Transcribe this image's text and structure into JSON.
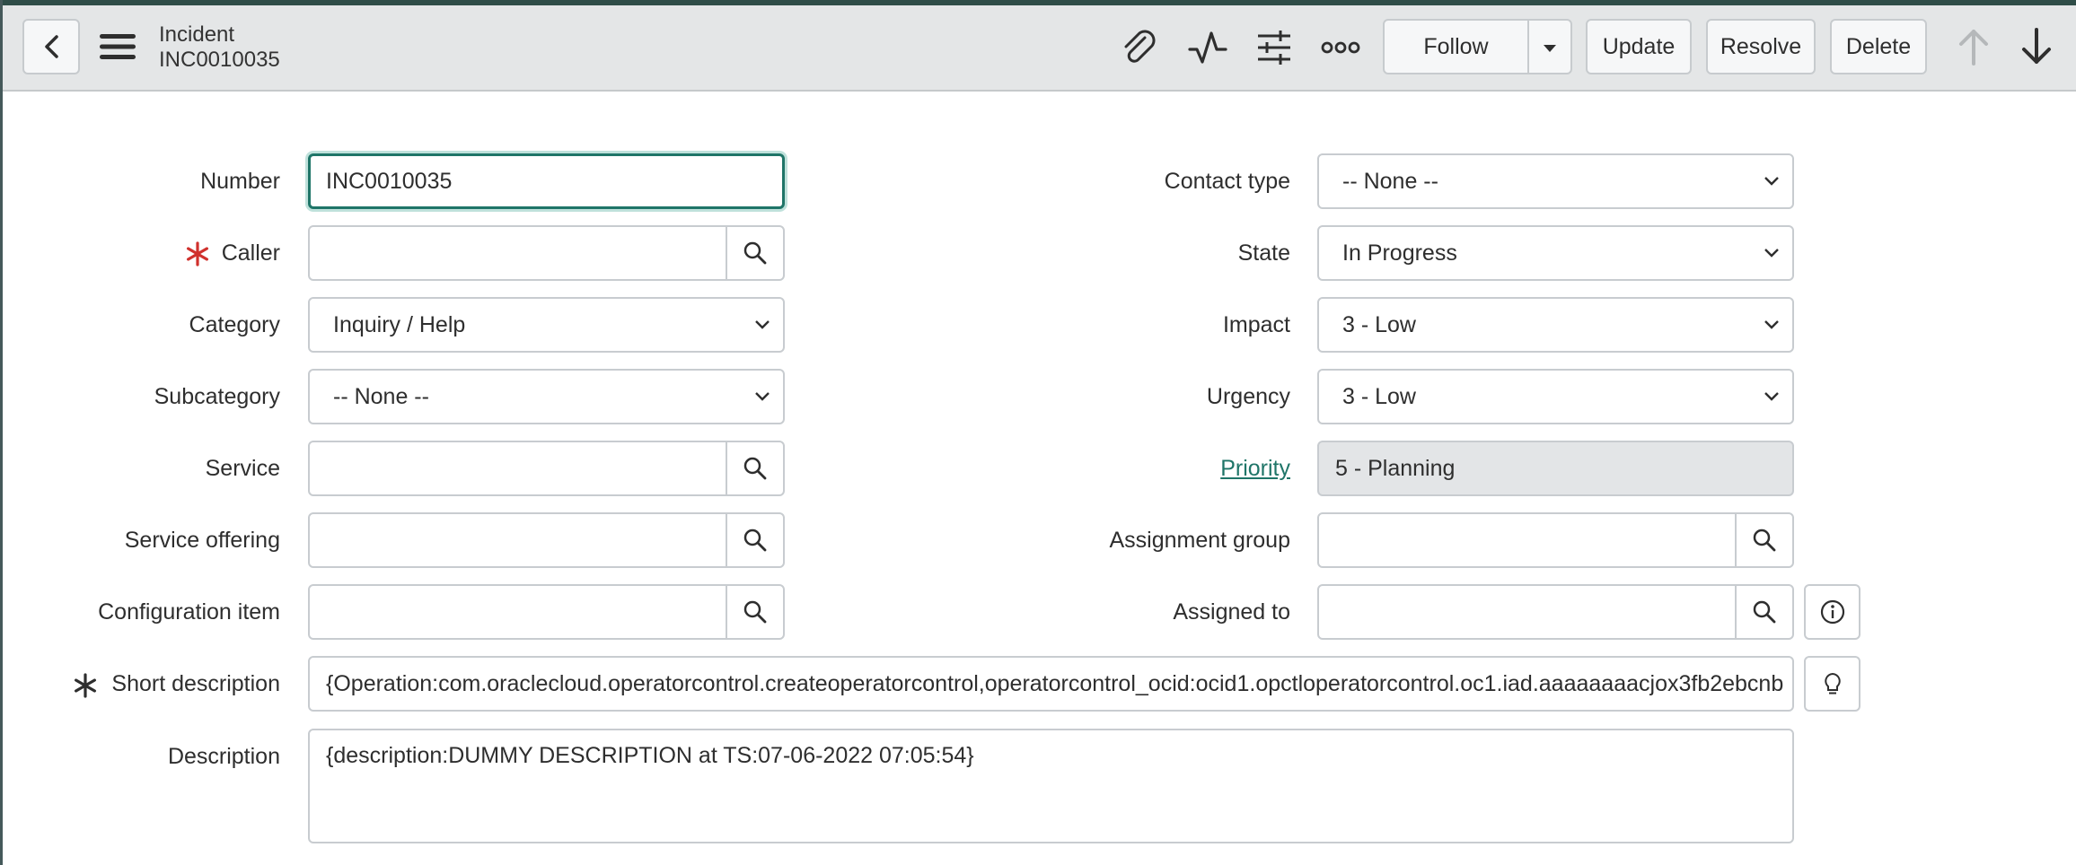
{
  "header": {
    "back_icon": "chevron-left-icon",
    "menu_icon": "hamburger-menu-icon",
    "title": "Incident",
    "subtitle": "INC0010035",
    "icons": [
      "paperclip-icon",
      "activity-pulse-icon",
      "sliders-icon",
      "more-dots-icon"
    ],
    "follow_label": "Follow",
    "update_label": "Update",
    "resolve_label": "Resolve",
    "delete_label": "Delete",
    "up_icon": "arrow-up-icon",
    "down_icon": "arrow-down-icon"
  },
  "form": {
    "number": {
      "label": "Number",
      "value": "INC0010035"
    },
    "caller": {
      "label": "Caller",
      "value": ""
    },
    "category": {
      "label": "Category",
      "value": "Inquiry / Help"
    },
    "subcategory": {
      "label": "Subcategory",
      "value": "-- None --"
    },
    "service": {
      "label": "Service",
      "value": ""
    },
    "service_offering": {
      "label": "Service offering",
      "value": ""
    },
    "configuration_item": {
      "label": "Configuration item",
      "value": ""
    },
    "contact_type": {
      "label": "Contact type",
      "value": "-- None --"
    },
    "state": {
      "label": "State",
      "value": "In Progress"
    },
    "impact": {
      "label": "Impact",
      "value": "3 - Low"
    },
    "urgency": {
      "label": "Urgency",
      "value": "3 - Low"
    },
    "priority": {
      "label": "Priority",
      "value": "5 - Planning"
    },
    "assignment_group": {
      "label": "Assignment group",
      "value": ""
    },
    "assigned_to": {
      "label": "Assigned to",
      "value": ""
    },
    "short_description": {
      "label": "Short description",
      "value": "{Operation:com.oraclecloud.operatorcontrol.createoperatorcontrol,operatorcontrol_ocid:ocid1.opctloperatorcontrol.oc1.iad.aaaaaaaacjox3fb2ebcnb"
    },
    "description": {
      "label": "Description",
      "value": "{description:DUMMY DESCRIPTION at TS:07-06-2022 07:05:54}"
    }
  },
  "colors": {
    "accent": "#1f7568",
    "required": "#d0312d",
    "header_bg": "#e4e6e7"
  }
}
